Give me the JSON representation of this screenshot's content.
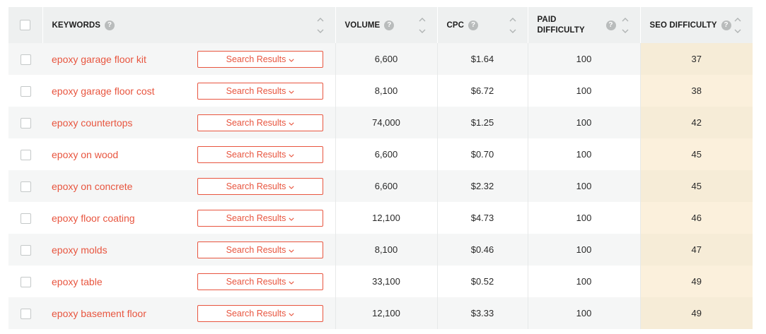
{
  "header": {
    "keywords": "KEYWORDS",
    "volume": "VOLUME",
    "cpc": "CPC",
    "paid_difficulty_line1": "PAID",
    "paid_difficulty_line2": "DIFFICULTY",
    "seo_difficulty": "SEO DIFFICULTY",
    "help_glyph": "?"
  },
  "search_results_label": "Search Results",
  "colors": {
    "accent": "#e8553f",
    "header_bg": "#eef0f0",
    "seo_column_bg": "#f6ecd7"
  },
  "rows": [
    {
      "keyword": "epoxy garage floor kit",
      "volume": "6,600",
      "cpc": "$1.64",
      "paid_difficulty": "100",
      "seo_difficulty": "37"
    },
    {
      "keyword": "epoxy garage floor cost",
      "volume": "8,100",
      "cpc": "$6.72",
      "paid_difficulty": "100",
      "seo_difficulty": "38"
    },
    {
      "keyword": "epoxy countertops",
      "volume": "74,000",
      "cpc": "$1.25",
      "paid_difficulty": "100",
      "seo_difficulty": "42"
    },
    {
      "keyword": "epoxy on wood",
      "volume": "6,600",
      "cpc": "$0.70",
      "paid_difficulty": "100",
      "seo_difficulty": "45"
    },
    {
      "keyword": "epoxy on concrete",
      "volume": "6,600",
      "cpc": "$2.32",
      "paid_difficulty": "100",
      "seo_difficulty": "45"
    },
    {
      "keyword": "epoxy floor coating",
      "volume": "12,100",
      "cpc": "$4.73",
      "paid_difficulty": "100",
      "seo_difficulty": "46"
    },
    {
      "keyword": "epoxy molds",
      "volume": "8,100",
      "cpc": "$0.46",
      "paid_difficulty": "100",
      "seo_difficulty": "47"
    },
    {
      "keyword": "epoxy table",
      "volume": "33,100",
      "cpc": "$0.52",
      "paid_difficulty": "100",
      "seo_difficulty": "49"
    },
    {
      "keyword": "epoxy basement floor",
      "volume": "12,100",
      "cpc": "$3.33",
      "paid_difficulty": "100",
      "seo_difficulty": "49"
    }
  ]
}
